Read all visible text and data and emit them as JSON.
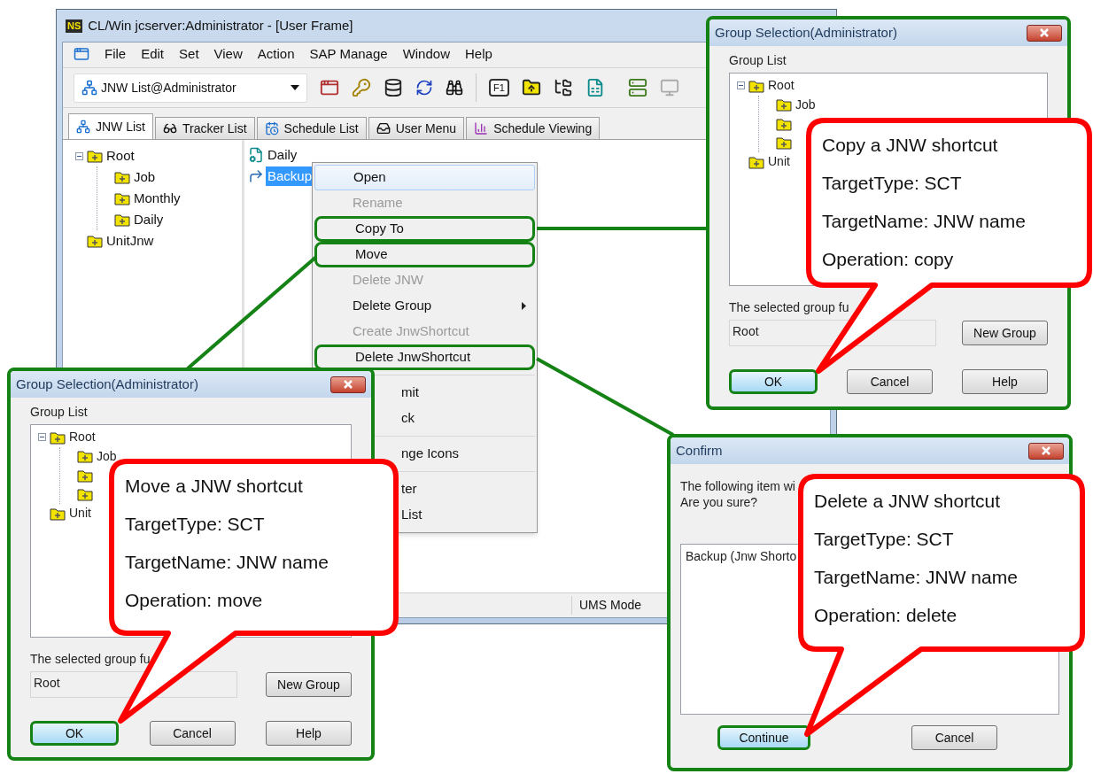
{
  "main_window": {
    "logo": "NS",
    "title": "CL/Win jcserver:Administrator - [User Frame]",
    "menu": [
      "File",
      "Edit",
      "Set",
      "View",
      "Action",
      "SAP Manage",
      "Window",
      "Help"
    ],
    "view_select": "JNW List@Administrator",
    "help_key": "F1",
    "tabs": [
      {
        "label": "JNW List",
        "selected": true
      },
      {
        "label": "Tracker List",
        "selected": false
      },
      {
        "label": "Schedule List",
        "selected": false
      },
      {
        "label": "User Menu",
        "selected": false
      },
      {
        "label": "Schedule Viewing",
        "selected": false
      }
    ],
    "tree": [
      {
        "kind": "group",
        "label": "Root",
        "expanded": true,
        "children": [
          {
            "kind": "group",
            "label": "Job"
          },
          {
            "kind": "group",
            "label": "Monthly"
          },
          {
            "kind": "group",
            "label": "Daily"
          }
        ]
      },
      {
        "kind": "group",
        "label": "UnitJnw"
      }
    ],
    "list": [
      {
        "label": "Daily",
        "kind": "jnw",
        "selected": false
      },
      {
        "label": "Backup",
        "kind": "shortcut",
        "selected": true
      }
    ],
    "status_bar": "UMS Mode"
  },
  "context_menu": [
    {
      "kind": "item",
      "label": "Open",
      "selected": true,
      "disabled": false,
      "submenu": false,
      "annotated": false
    },
    {
      "kind": "item",
      "label": "Rename",
      "selected": false,
      "disabled": true,
      "submenu": false,
      "annotated": false
    },
    {
      "kind": "item",
      "label": "Copy To",
      "selected": false,
      "disabled": false,
      "submenu": false,
      "annotated": true
    },
    {
      "kind": "item",
      "label": "Move",
      "selected": false,
      "disabled": false,
      "submenu": false,
      "annotated": true
    },
    {
      "kind": "item",
      "label": "Delete JNW",
      "selected": false,
      "disabled": true,
      "submenu": false,
      "annotated": false
    },
    {
      "kind": "item",
      "label": "Delete Group",
      "selected": false,
      "disabled": false,
      "submenu": true,
      "annotated": false
    },
    {
      "kind": "item",
      "label": "Create JnwShortcut",
      "selected": false,
      "disabled": true,
      "submenu": false,
      "annotated": false
    },
    {
      "kind": "item",
      "label": "Delete JnwShortcut",
      "selected": false,
      "disabled": false,
      "submenu": false,
      "annotated": true
    },
    {
      "kind": "separator"
    },
    {
      "kind": "partial",
      "label": "mit"
    },
    {
      "kind": "partial",
      "label": "ck"
    },
    {
      "kind": "separator"
    },
    {
      "kind": "partial",
      "label": "nge Icons"
    },
    {
      "kind": "separator"
    },
    {
      "kind": "partial",
      "label": "ter"
    },
    {
      "kind": "partial",
      "label": "List"
    }
  ],
  "copy_dialog": {
    "title": "Group Selection(Administrator)",
    "tree_label": "Group List",
    "tree": [
      {
        "kind": "group",
        "label": "Root",
        "expanded": true,
        "children": [
          {
            "kind": "group",
            "label": "Job"
          },
          {
            "kind": "group"
          },
          {
            "kind": "group"
          }
        ]
      },
      {
        "kind": "group",
        "label": "Unit"
      }
    ],
    "selected_label": "The selected group fu",
    "selected_value": "Root",
    "new_group": "New Group",
    "buttons": [
      {
        "label": "OK",
        "focused": true,
        "annotated": true
      },
      {
        "label": "Cancel",
        "focused": false,
        "annotated": false
      },
      {
        "label": "Help",
        "focused": false,
        "annotated": false
      }
    ],
    "callout": [
      "Copy a JNW shortcut",
      "TargetType: SCT",
      "TargetName: JNW name",
      "Operation: copy"
    ]
  },
  "move_dialog": {
    "title": "Group Selection(Administrator)",
    "tree_label": "Group List",
    "tree": [
      {
        "kind": "group",
        "label": "Root",
        "expanded": true,
        "children": [
          {
            "kind": "group",
            "label": "Job"
          },
          {
            "kind": "group"
          },
          {
            "kind": "group"
          }
        ]
      },
      {
        "kind": "group",
        "label": "Unit"
      }
    ],
    "selected_label": "The selected group fu",
    "selected_value": "Root",
    "new_group": "New Group",
    "buttons": [
      {
        "label": "OK",
        "focused": true,
        "annotated": true
      },
      {
        "label": "Cancel",
        "focused": false,
        "annotated": false
      },
      {
        "label": "Help",
        "focused": false,
        "annotated": false
      }
    ],
    "callout": [
      "Move a JNW shortcut",
      "TargetType: SCT",
      "TargetName: JNW name",
      "Operation: move"
    ]
  },
  "confirm_dialog": {
    "title": "Confirm",
    "message": [
      "The following item wi",
      "Are you sure?"
    ],
    "items": [
      "Backup (Jnw Shorto"
    ],
    "buttons": [
      {
        "label": "Continue",
        "focused": true,
        "annotated": true
      },
      {
        "label": "Cancel",
        "focused": false,
        "annotated": false
      }
    ],
    "callout": [
      "Delete a JNW shortcut",
      "TargetType: SCT",
      "TargetName: JNW name",
      "Operation: delete"
    ]
  }
}
